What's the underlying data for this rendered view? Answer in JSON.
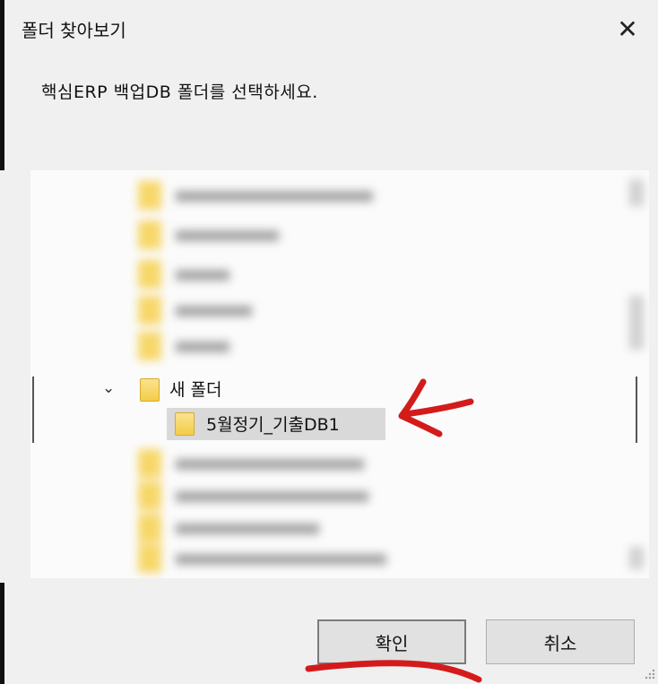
{
  "dialog": {
    "title": "폴더 찾아보기",
    "close_glyph": "✕",
    "description": "핵심ERP 백업DB 폴더를 선택하세요."
  },
  "tree": {
    "expanded_folder": {
      "label": "새 폴더",
      "chevron_glyph": "⌄",
      "icon": "folder-icon"
    },
    "selected_folder": {
      "label": "5월정기_기출DB1",
      "icon": "folder-icon",
      "selected": true
    },
    "other_items_blurred": true
  },
  "buttons": {
    "ok_label": "확인",
    "cancel_label": "취소"
  },
  "annotations": {
    "arrow_color": "#d41b1b",
    "underline_color": "#d41b1b"
  }
}
